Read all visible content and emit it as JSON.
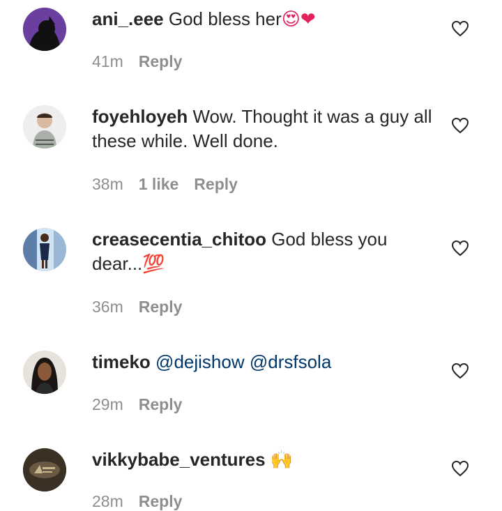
{
  "comments": [
    {
      "username": "ani_.eee",
      "text": "God bless her",
      "emoji": "😍❤",
      "time": "41m",
      "likes": "",
      "reply_label": "Reply"
    },
    {
      "username": "foyehloyeh",
      "text": "Wow. Thought it was a guy all these while. Well done.",
      "emoji": "",
      "time": "38m",
      "likes": "1 like",
      "reply_label": "Reply"
    },
    {
      "username": "creasecentia_chitoo",
      "text": "God bless you dear...",
      "emoji": "💯",
      "time": "36m",
      "likes": "",
      "reply_label": "Reply"
    },
    {
      "username": "timeko",
      "mention1": "@dejishow",
      "mention2": "@drsfsola",
      "time": "29m",
      "likes": "",
      "reply_label": "Reply"
    },
    {
      "username": "vikkybabe_ventures",
      "text": "",
      "emoji": "🙌",
      "time": "28m",
      "likes": "",
      "reply_label": "Reply"
    }
  ],
  "icons": {
    "like": "heart-outline-icon"
  },
  "colors": {
    "text": "#262626",
    "meta": "#8e8e8e",
    "mention": "#00376b"
  }
}
